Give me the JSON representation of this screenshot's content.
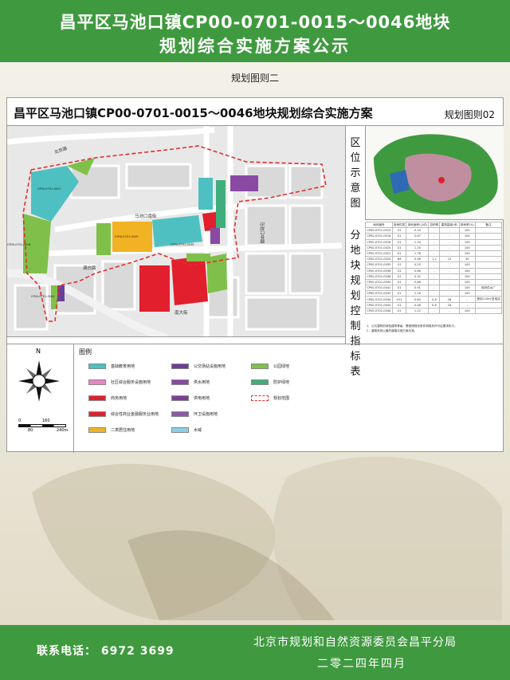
{
  "header": {
    "title_line1": "昌平区马池口镇CP00-0701-0015～0046地块",
    "title_line2": "规划综合实施方案公示"
  },
  "subtitle": "规划图则二",
  "panel": {
    "title": "昌平区马池口镇CP00-0701-0015～0046地块规划综合实施方案",
    "code": "规划图则02",
    "overview_label": [
      "区",
      "位",
      "示",
      "意",
      "图"
    ],
    "table_label": [
      "分",
      "地",
      "块",
      "规",
      "划",
      "控",
      "制",
      "指",
      "标",
      "表"
    ]
  },
  "map": {
    "roads": [
      "马池口南街",
      "满白路",
      "南大街",
      "马池口中路",
      "北京路"
    ],
    "parcel_codes": [
      "CP00-0701-0021",
      "CP00-0701-0018",
      "CP00-0701-0020",
      "CP00-0701-0039",
      "CP00-0701-0044"
    ]
  },
  "control_table": {
    "headers": [
      "地块编号",
      "用地性质",
      "用地面积(公顷)",
      "容积率",
      "建筑高度(米)",
      "绿地率(%)",
      "备注"
    ],
    "rows": [
      [
        "CP00-0701-0015",
        "G1",
        "0.14",
        "-",
        "-",
        "100",
        ""
      ],
      [
        "CP00-0701-0016",
        "G1",
        "0.67",
        "-",
        "-",
        "100",
        ""
      ],
      [
        "CP00-0701-0018",
        "G1",
        "1.34",
        "-",
        "-",
        "100",
        ""
      ],
      [
        "CP00-0701-0020",
        "G1",
        "1.25",
        "-",
        "-",
        "100",
        ""
      ],
      [
        "CP00-0701-0021",
        "G1",
        "1.78",
        "-",
        "-",
        "100",
        ""
      ],
      [
        "CP00-0701-0024",
        "B4",
        "0.46",
        "1.2",
        "12",
        "30",
        ""
      ],
      [
        "CP00-0701-0030",
        "G1",
        "0.25",
        "-",
        "-",
        "100",
        ""
      ],
      [
        "CP00-0701-0036",
        "G1",
        "0.66",
        "-",
        "-",
        "100",
        ""
      ],
      [
        "CP00-0701-0038",
        "G1",
        "0.32",
        "-",
        "-",
        "100",
        ""
      ],
      [
        "CP00-0701-0040",
        "G1",
        "0.88",
        "-",
        "-",
        "100",
        ""
      ],
      [
        "CP00-0701-0041",
        "G1",
        "0.91",
        "-",
        "-",
        "100",
        "现状供水厂"
      ],
      [
        "CP00-0701-0042",
        "G1",
        "2.18",
        "-",
        "-",
        "100",
        ""
      ],
      [
        "CP00-0701-0044",
        "U11",
        "0.84",
        "0.8",
        "18",
        "-",
        "规划110kV变电站"
      ],
      [
        "CP00-0701-0045",
        "G1",
        "0.48",
        "0.8",
        "18",
        "-",
        ""
      ],
      [
        "CP00-0701-0046",
        "G1",
        "1.12",
        "-",
        "-",
        "100",
        ""
      ]
    ],
    "notes": [
      "1、公共建筑的绿色建筑等级：需按照规划条件和规划许可证要求执行。",
      "2、道路系统以最终道路实施方案为准。"
    ]
  },
  "legend": {
    "title": "图例",
    "compass_north": "N",
    "scale_labels": [
      "0",
      "160",
      "80",
      "240m"
    ],
    "items": [
      {
        "label": "基础教育用地",
        "color": "#4ec0c2"
      },
      {
        "label": "社区综合服务设施用地",
        "color": "#e784c8"
      },
      {
        "label": "商务用地",
        "color": "#e21f2c"
      },
      {
        "label": "综合性商业金融服务业用地",
        "color": "#e21f2c"
      },
      {
        "label": "二类居住用地",
        "color": "#f1b324"
      },
      {
        "label": "公交场站设施用地",
        "color": "#6a3f97"
      },
      {
        "label": "供水用地",
        "color": "#8a4aa4"
      },
      {
        "label": "供电用地",
        "color": "#7c3f95"
      },
      {
        "label": "环卫设施用地",
        "color": "#8c5aa8"
      },
      {
        "label": "水域",
        "color": "#8ccfe8"
      },
      {
        "label": "公园绿地",
        "color": "#7fc04a"
      },
      {
        "label": "防护绿地",
        "color": "#3fae7c"
      },
      {
        "label": "规划范围",
        "color": "#e03030"
      }
    ]
  },
  "footer": {
    "phone": "联系电话： 6972 3699",
    "org": "北京市规划和自然资源委员会昌平分局",
    "date": "二零二四年四月"
  },
  "colors": {
    "banner_green": "#3f9a3f",
    "boundary_red": "#e03030"
  }
}
